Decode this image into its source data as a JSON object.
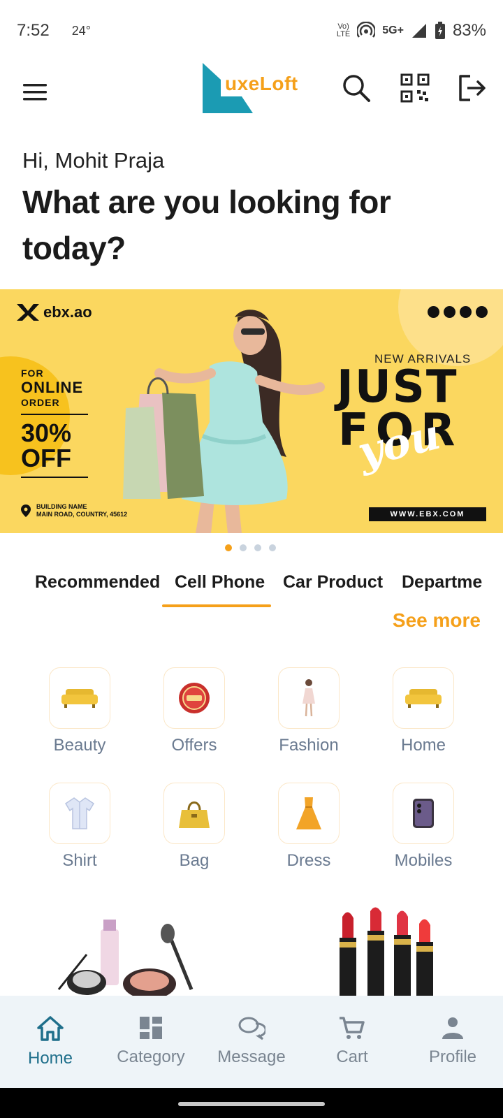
{
  "status_bar": {
    "time": "7:52",
    "temperature": "24°",
    "network_top": "Vo)",
    "network_bottom": "LTE",
    "network_type": "5G+",
    "battery": "83%"
  },
  "header": {
    "logo_text": "uxeLoft",
    "logo_colors": {
      "teal": "#1b9bb3",
      "orange": "#f5a01a"
    }
  },
  "greeting": {
    "hello": "Hi, Mohit Praja",
    "headline": "What are you looking for today?"
  },
  "banner": {
    "brand": "ebx.ao",
    "offer_for": "FOR",
    "offer_online": "ONLINE",
    "offer_order": "ORDER",
    "offer_percent": "30%",
    "offer_off": "OFF",
    "address_line1": "BUILDING NAME",
    "address_line2": "MAIN ROAD, COUNTRY, 45612",
    "new_arrivals": "NEW ARRIVALS",
    "just": "JUST",
    "for": "FOR",
    "you": "you",
    "website": "WWW.EBX.COM",
    "background_color": "#fbd75f"
  },
  "carousel": {
    "count": 4,
    "active_index": 0
  },
  "tabs": {
    "items": [
      "Recommended",
      "Cell Phone",
      "Car Product",
      "Departme"
    ],
    "active_index": 1
  },
  "see_more": "See more",
  "categories": [
    {
      "label": "Beauty",
      "icon": "sofa-icon"
    },
    {
      "label": "Offers",
      "icon": "offer-badge-icon"
    },
    {
      "label": "Fashion",
      "icon": "fashion-model-icon"
    },
    {
      "label": "Home",
      "icon": "sofa-icon"
    },
    {
      "label": "Shirt",
      "icon": "shirt-icon"
    },
    {
      "label": "Bag",
      "icon": "handbag-icon"
    },
    {
      "label": "Dress",
      "icon": "dress-icon"
    },
    {
      "label": "Mobiles",
      "icon": "phone-icon"
    }
  ],
  "bottom_nav": {
    "items": [
      "Home",
      "Category",
      "Message",
      "Cart",
      "Profile"
    ],
    "active_index": 0,
    "active_color": "#1f6f8b"
  },
  "accent_color": "#f5a01a"
}
